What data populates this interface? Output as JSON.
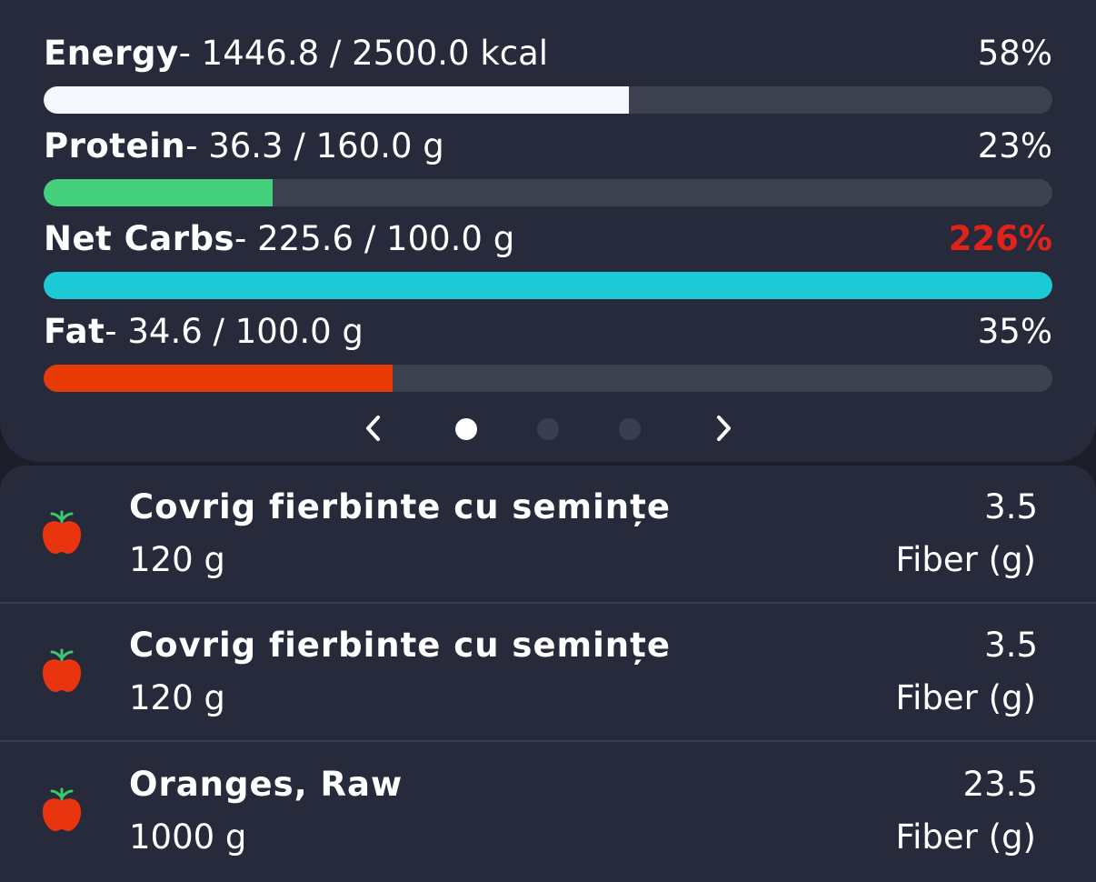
{
  "nutrients": [
    {
      "name": "Energy",
      "amount": "- 1446.8 / 2500.0 kcal",
      "percent_label": "58%",
      "progress": 0.58,
      "color": "#f7f8ff",
      "over": false
    },
    {
      "name": "Protein",
      "amount": "- 36.3 / 160.0 g",
      "percent_label": "23%",
      "progress": 0.227,
      "color": "#44d07d",
      "over": false
    },
    {
      "name": "Net Carbs",
      "amount": "- 225.6 / 100.0 g",
      "percent_label": "226%",
      "progress": 1.0,
      "color": "#1ccad6",
      "over": true
    },
    {
      "name": "Fat",
      "amount": "- 34.6 / 100.0 g",
      "percent_label": "35%",
      "progress": 0.346,
      "color": "#e73a06",
      "over": false
    }
  ],
  "pager": {
    "pages": 3,
    "active": 0,
    "prev_icon": "chevron-left-icon",
    "next_icon": "chevron-right-icon"
  },
  "foods": [
    {
      "name": "Covrig fierbinte cu semințe",
      "quantity": "120 g",
      "value": "3.5",
      "unit": "Fiber (g)",
      "icon": "apple-icon"
    },
    {
      "name": "Covrig fierbinte cu semințe",
      "quantity": "120 g",
      "value": "3.5",
      "unit": "Fiber (g)",
      "icon": "apple-icon"
    },
    {
      "name": "Oranges, Raw",
      "quantity": "1000 g",
      "value": "23.5",
      "unit": "Fiber (g)",
      "icon": "apple-icon"
    }
  ],
  "colors": {
    "over_target": "#e0221b",
    "apple_red": "#e8340f",
    "apple_leaf": "#3cc86a"
  }
}
